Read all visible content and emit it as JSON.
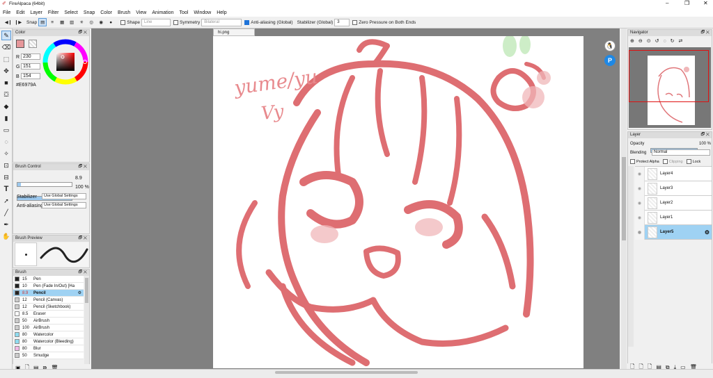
{
  "window": {
    "title": "FireAlpaca (64bit)"
  },
  "menu": [
    "File",
    "Edit",
    "Layer",
    "Filter",
    "Select",
    "Snap",
    "Color",
    "Brush",
    "View",
    "Animation",
    "Tool",
    "Window",
    "Help"
  ],
  "toolbar": {
    "snap_label": "Snap",
    "shape_label": "Shape",
    "shape_value": "Line",
    "symmetry_label": "Symmetry",
    "symmetry_value": "Bilateral",
    "antialias_label": "Anti-aliasing (Global)",
    "stabilizer_label": "Stabilizer (Global)",
    "stabilizer_value": "3",
    "zero_pressure_label": "Zero Pressure on Both Ends"
  },
  "color_panel": {
    "title": "Color",
    "r_label": "R",
    "r_value": "230",
    "g_label": "G",
    "g_value": "151",
    "b_label": "B",
    "b_value": "154",
    "hex": "#E6979A",
    "current_color": "#e6979a"
  },
  "brush_control": {
    "title": "Brush Control",
    "size_value": "8.9",
    "size_fraction": 0.06,
    "opacity_value": "100 %",
    "opacity_fraction": 1.0,
    "stabilizer_label": "Stabilizer",
    "stabilizer_value": "Use Global Settings",
    "antialias_label": "Anti-aliasing",
    "antialias_value": "Use Global Settings"
  },
  "brush_preview": {
    "title": "Brush Preview"
  },
  "brush_panel": {
    "title": "Brush",
    "items": [
      {
        "size": "15",
        "name": "Pen",
        "color": "#222222"
      },
      {
        "size": "10",
        "name": "Pen (Fade In/Out) [Ha",
        "color": "#222222"
      },
      {
        "size": "8.9",
        "name": "Pencil",
        "color": "#222222"
      },
      {
        "size": "12",
        "name": "Pencil (Canvas)",
        "color": "#cccccc"
      },
      {
        "size": "12",
        "name": "Pencil (Sketchbook)",
        "color": "#cccccc"
      },
      {
        "size": "8.5",
        "name": "Eraser",
        "color": "#ffffff"
      },
      {
        "size": "50",
        "name": "AirBrush",
        "color": "#cccccc"
      },
      {
        "size": "100",
        "name": "AirBrush",
        "color": "#cccccc"
      },
      {
        "size": "80",
        "name": "Watercolor",
        "color": "#8fdcf0"
      },
      {
        "size": "80",
        "name": "Watercolor (Bleeding)",
        "color": "#8fdcf0"
      },
      {
        "size": "80",
        "name": "Blur",
        "color": "#f2b8e6"
      },
      {
        "size": "50",
        "name": "Smudge",
        "color": "#cccccc"
      }
    ]
  },
  "document": {
    "tab": "hi.png",
    "text1": "yume/yu",
    "text2": "Vy"
  },
  "navigator": {
    "title": "Navigator"
  },
  "layer_panel": {
    "title": "Layer",
    "opacity_label": "Opacity",
    "opacity_value": "100 %",
    "blending_label": "Blending",
    "blending_value": "Normal",
    "protect_alpha": "Protect Alpha",
    "clipping": "Clipping",
    "lock": "Lock",
    "layers": [
      "Layer4",
      "Layer3",
      "Layer2",
      "Layer1",
      "Layer5"
    ]
  },
  "colors": {
    "accent": "#1e73d8",
    "selection": "#9fd2f3",
    "sketch": "#d9555a"
  }
}
